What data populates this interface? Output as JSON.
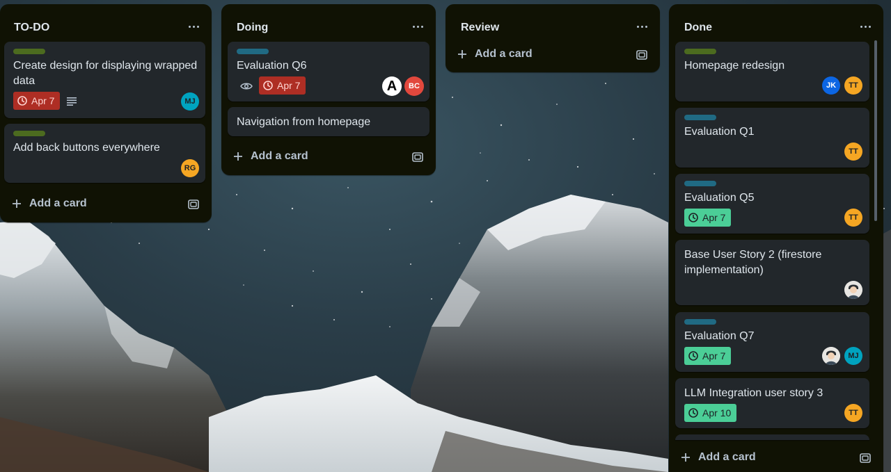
{
  "lists": [
    {
      "title": "TO-DO",
      "cards": [
        {
          "label": "green",
          "title": "Create design for displaying wrapped data",
          "badge": "Apr 7",
          "badge_status": "overdue",
          "has_description": true,
          "members": [
            "MJ"
          ]
        },
        {
          "label": "green",
          "title": "Add back buttons everywhere",
          "members": [
            "RG"
          ]
        }
      ],
      "add_label": "Add a card"
    },
    {
      "title": "Doing",
      "cards": [
        {
          "label": "blue",
          "title": "Evaluation Q6",
          "watching": true,
          "badge": "Apr 7",
          "badge_status": "overdue",
          "members": [
            "A",
            "BC"
          ]
        },
        {
          "title": "Navigation from homepage"
        }
      ],
      "add_label": "Add a card"
    },
    {
      "title": "Review",
      "cards": [],
      "add_label": "Add a card"
    },
    {
      "title": "Done",
      "cards": [
        {
          "label": "green",
          "title": "Homepage redesign",
          "members": [
            "JK",
            "TT"
          ]
        },
        {
          "label": "blue",
          "title": "Evaluation Q1",
          "members": [
            "TT"
          ]
        },
        {
          "label": "blue",
          "title": "Evaluation Q5",
          "badge": "Apr 7",
          "badge_status": "complete",
          "members": [
            "TT"
          ]
        },
        {
          "title": "Base User Story 2 (firestore implementation)",
          "members": [
            "photo-avatar"
          ]
        },
        {
          "label": "blue",
          "title": "Evaluation Q7",
          "badge": "Apr 7",
          "badge_status": "complete",
          "members": [
            "photo-avatar",
            "MJ"
          ]
        },
        {
          "title": "LLM Integration user story 3",
          "badge": "Apr 10",
          "badge_status": "complete",
          "members": [
            "TT"
          ]
        }
      ],
      "add_label": "Add a card"
    }
  ],
  "colors": {
    "list_bg": "#101204",
    "card_bg": "#22272b",
    "label_green": "#4c6b1f",
    "label_blue": "#206a83",
    "badge_overdue": "#ae2e24",
    "badge_complete": "#4bce97"
  },
  "icons": [
    "more-icon",
    "clock-icon",
    "description-icon",
    "eye-icon",
    "plus-icon",
    "template-icon"
  ]
}
